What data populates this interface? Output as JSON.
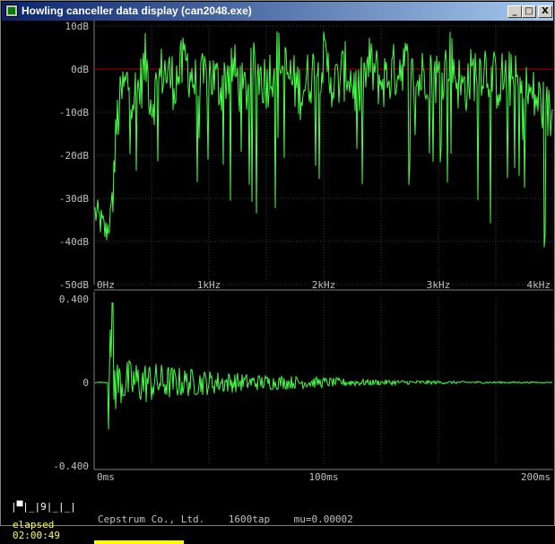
{
  "window": {
    "title": "Howling canceller data display (can2048.exe)",
    "buttons": {
      "minimize": "_",
      "maximize": "□",
      "close": "X"
    }
  },
  "colors": {
    "trace": "#44ff44",
    "zero_db_line": "#b00000",
    "grid": "#3a3a3a",
    "axis_text": "#c0c0c0",
    "status_text": "#ffff40",
    "progress": "#ffff00"
  },
  "spectrum_plot": {
    "y_ticks": [
      "10dB",
      "0dB",
      "-10dB",
      "-20dB",
      "-30dB",
      "-40dB",
      "-50dB"
    ],
    "x_ticks": [
      "0Hz",
      "1kHz",
      "2kHz",
      "3kHz",
      "4kHz"
    ],
    "reference_line": "0dB"
  },
  "impulse_plot": {
    "y_ticks": [
      "0.400",
      "0",
      "-0.400"
    ],
    "x_ticks": [
      "0ms",
      "100ms",
      "200ms"
    ]
  },
  "status": {
    "segment_indicator": "|▀|_|9|_|_|",
    "elapsed_label": "elapsed",
    "elapsed_time": "02:00:49",
    "progress_fraction": 0.25
  },
  "footer": {
    "company": "Cepstrum Co., Ltd.",
    "taps": "1600tap",
    "mu": "mu=0.00002"
  },
  "chart_data": [
    {
      "type": "line",
      "name_hint": "",
      "xlabel": "",
      "ylabel": "",
      "x_unit": "Hz",
      "y_unit": "dB",
      "xlim": [
        0,
        4000
      ],
      "ylim": [
        -50,
        10
      ],
      "x_ticks": [
        0,
        1000,
        2000,
        3000,
        4000
      ],
      "y_ticks": [
        10,
        0,
        -10,
        -20,
        -30,
        -40,
        -50
      ],
      "grid": true,
      "series": [
        {
          "x": [
            0,
            50,
            100,
            150,
            200,
            250,
            300,
            350,
            400,
            450,
            500,
            600,
            700,
            800,
            900,
            1000,
            1100,
            1200,
            1300,
            1400,
            1500,
            1600,
            1700,
            1800,
            1900,
            2000,
            2100,
            2200,
            2300,
            2400,
            2500,
            2600,
            2700,
            2800,
            2900,
            3000,
            3100,
            3200,
            3300,
            3400,
            3500,
            3600,
            3700,
            3800,
            3900,
            4000
          ],
          "values": [
            -33,
            -35,
            -38,
            -34,
            -12,
            -5,
            -3,
            -6,
            -4,
            2,
            -8,
            0,
            -3,
            2,
            -5,
            -1,
            -4,
            1,
            -6,
            0,
            -3,
            3,
            -2,
            -5,
            -1,
            2,
            -4,
            0,
            -6,
            1,
            -3,
            -1,
            2,
            -4,
            0,
            -2,
            3,
            -5,
            -1,
            1,
            -3,
            -2,
            -4,
            -6,
            -8,
            -12
          ]
        }
      ]
    },
    {
      "type": "line",
      "xlabel": "",
      "ylabel": "",
      "x_unit": "ms",
      "xlim": [
        0,
        200
      ],
      "ylim": [
        -0.4,
        0.4
      ],
      "x_ticks": [
        0,
        100,
        200
      ],
      "y_ticks": [
        0.4,
        0,
        -0.4
      ],
      "grid": true,
      "series": [
        {
          "x": [
            0,
            5,
            10,
            15,
            20,
            25,
            30,
            40,
            50,
            60,
            70,
            80,
            90,
            100,
            110,
            120,
            130,
            140,
            150,
            160,
            170,
            180,
            190,
            200
          ],
          "envelope": [
            0.0,
            0.38,
            0.12,
            0.11,
            0.11,
            0.1,
            0.09,
            0.07,
            0.06,
            0.05,
            0.04,
            0.035,
            0.03,
            0.025,
            0.02,
            0.015,
            0.012,
            0.01,
            0.008,
            0.006,
            0.005,
            0.004,
            0.003,
            0.002
          ]
        }
      ]
    }
  ]
}
